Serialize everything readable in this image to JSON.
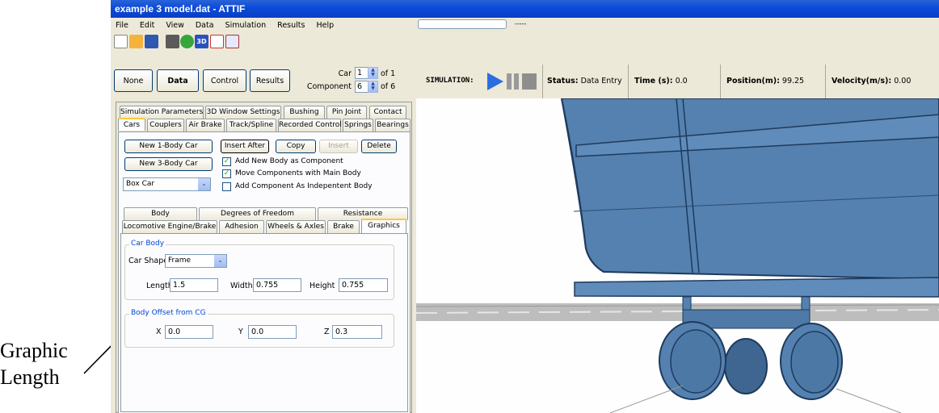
{
  "window": {
    "title": "example 3 model.dat - ATTIF"
  },
  "menu": [
    "File",
    "Edit",
    "View",
    "Data",
    "Simulation",
    "Results",
    "Help"
  ],
  "toolbar": {
    "icons": [
      "new-file-icon",
      "open-file-icon",
      "save-icon",
      "print-icon",
      "help-icon",
      "3d-view-icon",
      "plot-icon",
      "3d-plot-icon"
    ],
    "progress_text": "-----"
  },
  "modes": {
    "none": "None",
    "data": "Data",
    "control": "Control",
    "results": "Results"
  },
  "selector": {
    "car_label": "Car",
    "car_value": "1",
    "car_of": "of 1",
    "component_label": "Component",
    "component_value": "6",
    "component_of": "of 6"
  },
  "simulation": {
    "label": "SIMULATION:",
    "status_label": "Status:",
    "status_value": "Data Entry",
    "time_label": "Time (s):",
    "time_value": "0.0",
    "position_label": "Position(m):",
    "position_value": "99.25",
    "velocity_label": "Velocity(m/s):",
    "velocity_value": "0.00"
  },
  "tabs_row1": [
    "Simulation Parameters",
    "3D Window Settings",
    "Bushing",
    "Pin Joint",
    "Contact"
  ],
  "tabs_row2": [
    "Cars",
    "Couplers",
    "Air Brake",
    "Track/Spline",
    "Recorded Control",
    "Springs",
    "Bearings"
  ],
  "cars": {
    "new_1body": "New 1-Body Car",
    "new_3body": "New 3-Body Car",
    "insert_after": "Insert After",
    "copy": "Copy",
    "insert": "Insert",
    "delete": "Delete",
    "add_new_body": "Add New Body as Component",
    "move_components": "Move Components with Main Body",
    "add_independent": "Add Component As Indepentent Body",
    "car_type": "Box Car",
    "checks": {
      "add_new_body": true,
      "move_components": true,
      "add_independent": false
    }
  },
  "subtabs_row1": [
    "Body",
    "Degrees of Freedom",
    "Resistance"
  ],
  "subtabs_row2": [
    "Locomotive Engine/Brake",
    "Adhesion",
    "Wheels & Axles",
    "Brake",
    "Graphics"
  ],
  "graphics": {
    "car_body_title": "Car Body",
    "car_shape_label": "Car Shape",
    "car_shape_value": "Frame",
    "length_label": "Length",
    "length_value": "1.5",
    "width_label": "Width",
    "width_value": "0.755",
    "height_label": "Height",
    "height_value": "0.755",
    "offset_title": "Body Offset from CG",
    "x_label": "X",
    "x_value": "0.0",
    "y_label": "Y",
    "y_value": "0.0",
    "z_label": "Z",
    "z_value": "0.3"
  },
  "callout": {
    "line1": "Graphic",
    "line2": "Length"
  },
  "colors": {
    "title_bar": "#0b4ad8",
    "car_body": "#5481b0",
    "play_button": "#2a6fe0",
    "tab_highlight": "#ffc83c"
  }
}
